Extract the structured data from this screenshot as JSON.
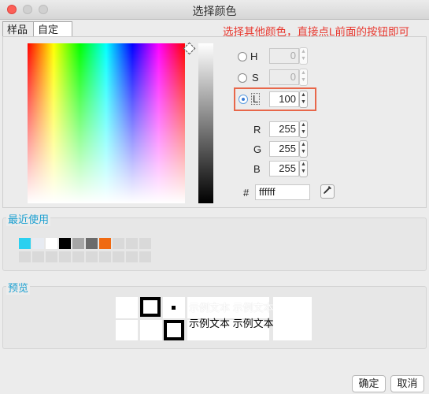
{
  "window": {
    "title": "选择颜色"
  },
  "tabs": [
    {
      "label": "样品"
    },
    {
      "label": "自定义"
    }
  ],
  "hint": "选择其他颜色，直接点L前面的按钮即可",
  "hsl": {
    "h": {
      "label": "H",
      "value": "0",
      "selected": false,
      "enabled": false
    },
    "s": {
      "label": "S",
      "value": "0",
      "selected": false,
      "enabled": false
    },
    "l": {
      "label": "L",
      "value": "100",
      "selected": true,
      "enabled": true
    }
  },
  "rgb": {
    "r": {
      "label": "R",
      "value": "255"
    },
    "g": {
      "label": "G",
      "value": "255"
    },
    "b": {
      "label": "B",
      "value": "255"
    }
  },
  "hex": {
    "label": "#",
    "value": "ffffff"
  },
  "recent": {
    "title": "最近使用",
    "row1": [
      "#2bd0f0",
      "#e7ebf2",
      "#ffffff",
      "#000000",
      "#a6a6a6",
      "#6b6b6b",
      "#f06a12",
      "#d9d9d9",
      "#d9d9d9",
      "#d9d9d9"
    ],
    "row2": [
      "#d9d9d9",
      "#d9d9d9",
      "#d9d9d9",
      "#d9d9d9",
      "#d9d9d9",
      "#d9d9d9",
      "#d9d9d9",
      "#d9d9d9",
      "#d9d9d9",
      "#d9d9d9"
    ]
  },
  "preview": {
    "title": "预览",
    "sample_text_1": "示例文本  示例文本",
    "sample_text_2": "示例文本  示例文本"
  },
  "buttons": {
    "ok": "确定",
    "cancel": "取消"
  },
  "icons": {
    "eyedropper": "eyedropper-icon"
  }
}
